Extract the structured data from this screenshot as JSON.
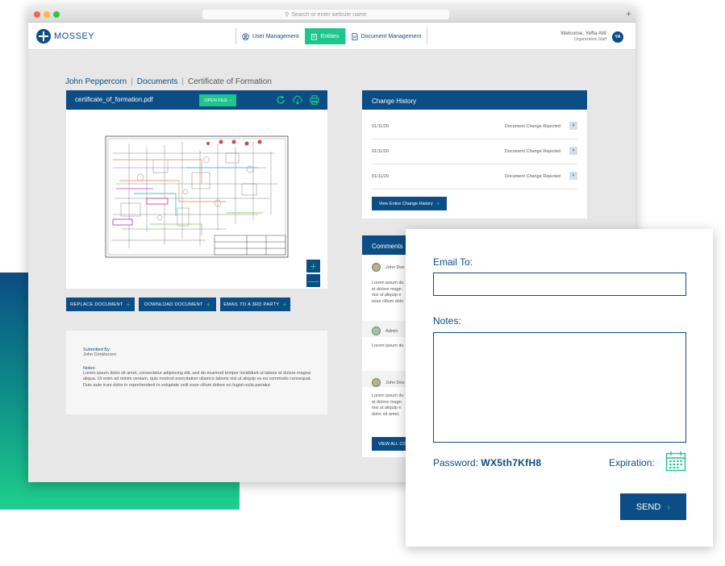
{
  "browser": {
    "url_placeholder": "Search or enter website name",
    "new_tab": "+"
  },
  "app": {
    "logo": "MOSSEY",
    "nav": [
      {
        "label": "User Management",
        "icon": "user-icon",
        "active": false
      },
      {
        "label": "Entities",
        "icon": "building-icon",
        "active": true
      },
      {
        "label": "Document Management",
        "icon": "document-icon",
        "active": false
      }
    ],
    "welcome": "Welcome, Yefta AW",
    "role": "Organization Staff",
    "avatar_initials": "YA"
  },
  "breadcrumb": [
    "John Peppercorn",
    "Documents",
    "Certificate of Formation"
  ],
  "viewer": {
    "filename": "certificate_of_formation.pdf",
    "open_file": "OPEN FILE",
    "zoom_in": "+",
    "zoom_out": "—"
  },
  "actions": [
    "REPLACE DOCUMENT",
    "DOWNLOAD DOCUMENT",
    "EMAIL TO A 3RD PARTY"
  ],
  "submission": {
    "submitted_by_label": "Submitted By:",
    "submitted_by": "John Crinklecorn",
    "notes_label": "Notes:",
    "notes": "Lorem ipsum dolor sit amet, consectetur adipiscing elit, sed do eiusmod tempor incididunt ut labore et dolore magna aliqua. Ut enim ad minim veniam, quis nostrud exercitation ullamco laboris nisi ut aliquip ex ea commodo consequat. Duis aute irure dolor in reprehenderit in voluptate velit esse cillum dolore eu fugiat nulla pariatur."
  },
  "history": {
    "title": "Change History",
    "rows": [
      {
        "date": "01/11/20",
        "status": "Document Change Rejected"
      },
      {
        "date": "01/11/20",
        "status": "Document Change Rejected"
      },
      {
        "date": "01/11/20",
        "status": "Document Change Rejected"
      }
    ],
    "view_all": "View Entire Change History"
  },
  "comments": {
    "title": "Comments",
    "items": [
      {
        "name": "John Doe",
        "text": "Lorem ipsum du\net dolore magn\nnisi ut aliquip e\nesse cillum dolo"
      },
      {
        "name": "Admin",
        "text": "Lorem ipsum du"
      },
      {
        "name": "John Doe",
        "text": "Lorem ipsum du\net dolore magn\nnisi ut aliquip e\ndolor sit amet,"
      }
    ],
    "view_all": "VIEW ALL CO"
  },
  "email_modal": {
    "email_label": "Email To:",
    "email_value": "",
    "notes_label": "Notes:",
    "notes_value": "",
    "password_label": "Password:",
    "password_value": "WX5th7KfH8",
    "expiration_label": "Expiration:",
    "send": "SEND"
  },
  "colors": {
    "brand_navy": "#0b4d84",
    "accent_green": "#1cc68d"
  }
}
